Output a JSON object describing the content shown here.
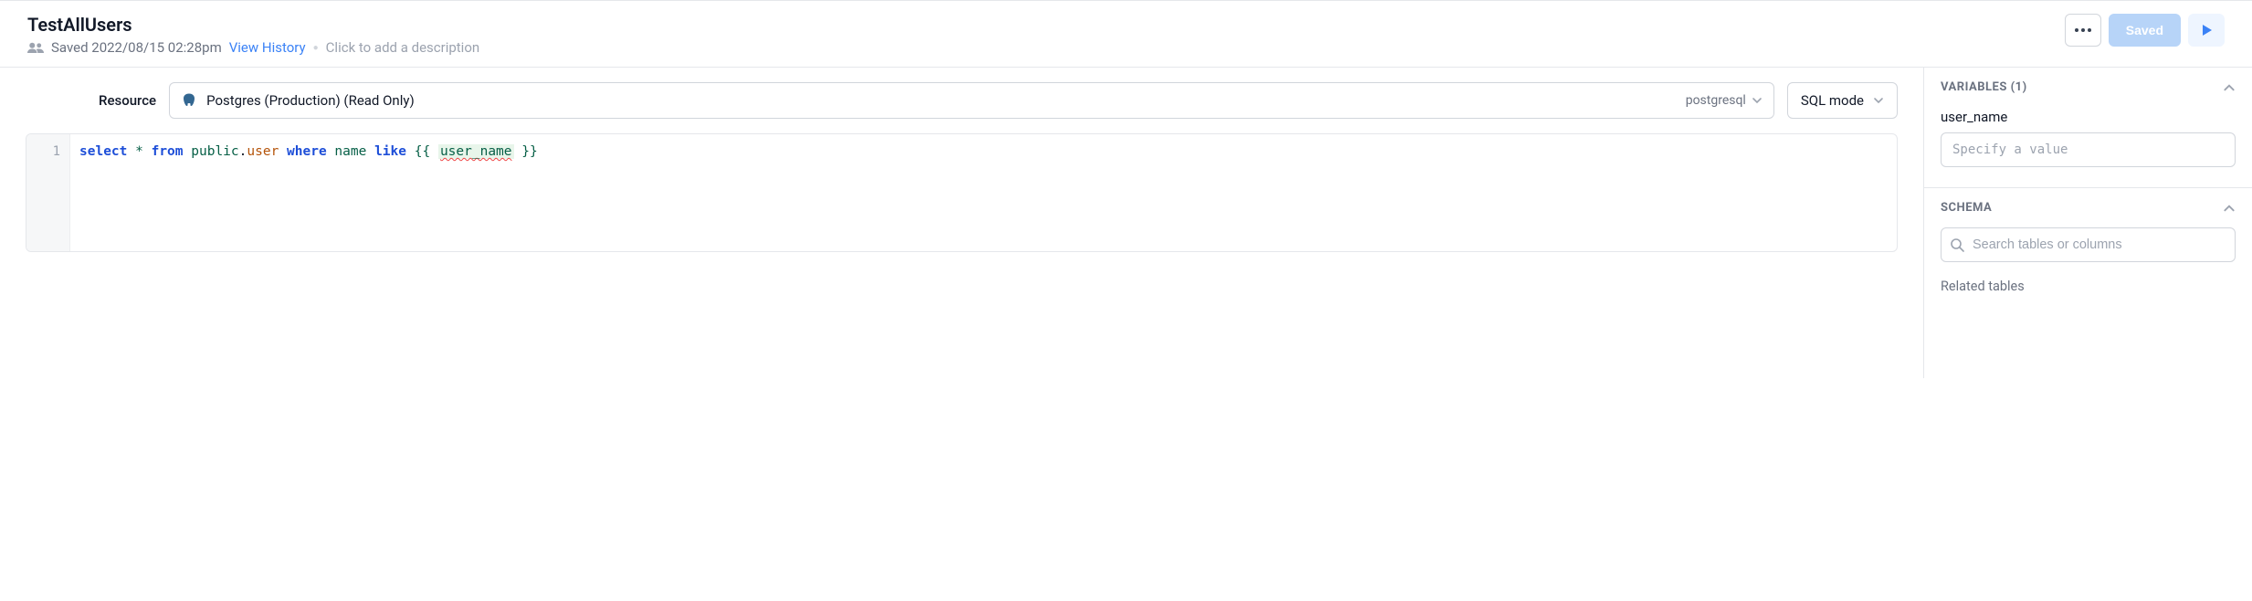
{
  "header": {
    "title": "TestAllUsers",
    "saved_text": "Saved 2022/08/15 02:28pm",
    "view_history": "View History",
    "description_placeholder": "Click to add a description",
    "saved_button": "Saved"
  },
  "resource": {
    "label": "Resource",
    "selected": "Postgres (Production) (Read Only)",
    "db_type": "postgresql",
    "mode": "SQL mode"
  },
  "editor": {
    "line_number": "1",
    "tokens": {
      "select": "select",
      "star": "*",
      "from": "from",
      "schema": "public",
      "dot": ".",
      "table": "user",
      "where": "where",
      "col": "name",
      "like": "like",
      "brace_open": "{{ ",
      "var": "user_name",
      "brace_close": " }}"
    }
  },
  "variables": {
    "header": "VARIABLES (1)",
    "items": [
      {
        "name": "user_name",
        "placeholder": "Specify a value"
      }
    ]
  },
  "schema": {
    "header": "SCHEMA",
    "search_placeholder": "Search tables or columns",
    "related_label": "Related tables"
  }
}
